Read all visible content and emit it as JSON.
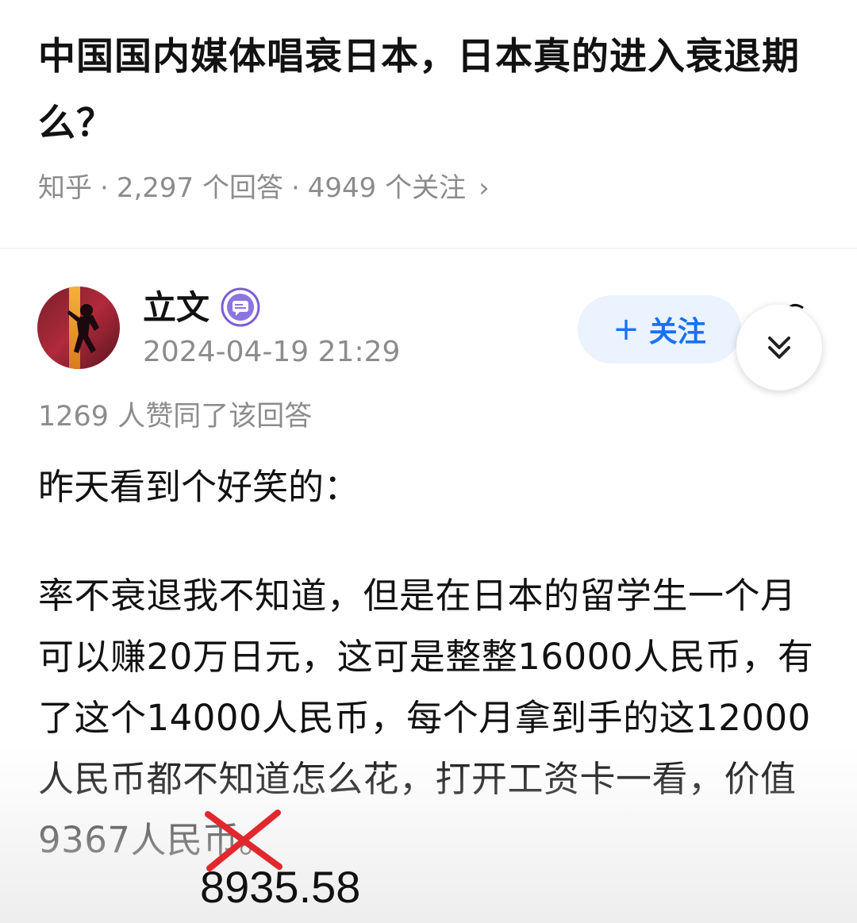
{
  "question": {
    "title": "中国国内媒体唱衰日本，日本真的进入衰退期么？",
    "source": "知乎",
    "answers": "2,297 个回答",
    "followers": "4949 个关注",
    "separator": "·",
    "chevron": "›"
  },
  "author": {
    "name": "立文",
    "time": "2024-04-19 21:29",
    "badge_icon": "chat-badge-icon",
    "follow_label": "关注",
    "follow_plus": "+"
  },
  "answer": {
    "likes": "1269 人赞同了该回答",
    "para1": "昨天看到个好笑的：",
    "para2": "率不衰退我不知道，但是在日本的留学生一个月可以赚20万日元，这可是整整16000人民币，有了这个14000人民币，每个月拿到手的这12000人民币都不知道怎么花，打开工资卡一看，价值9367人民币。",
    "correction": "8935.58"
  },
  "colors": {
    "accent": "#1772f6",
    "follow_bg": "#eaf3ff",
    "meta_gray": "#8c8c8c",
    "strike_red": "#e0282e",
    "badge_purple": "#7b5fd6"
  }
}
